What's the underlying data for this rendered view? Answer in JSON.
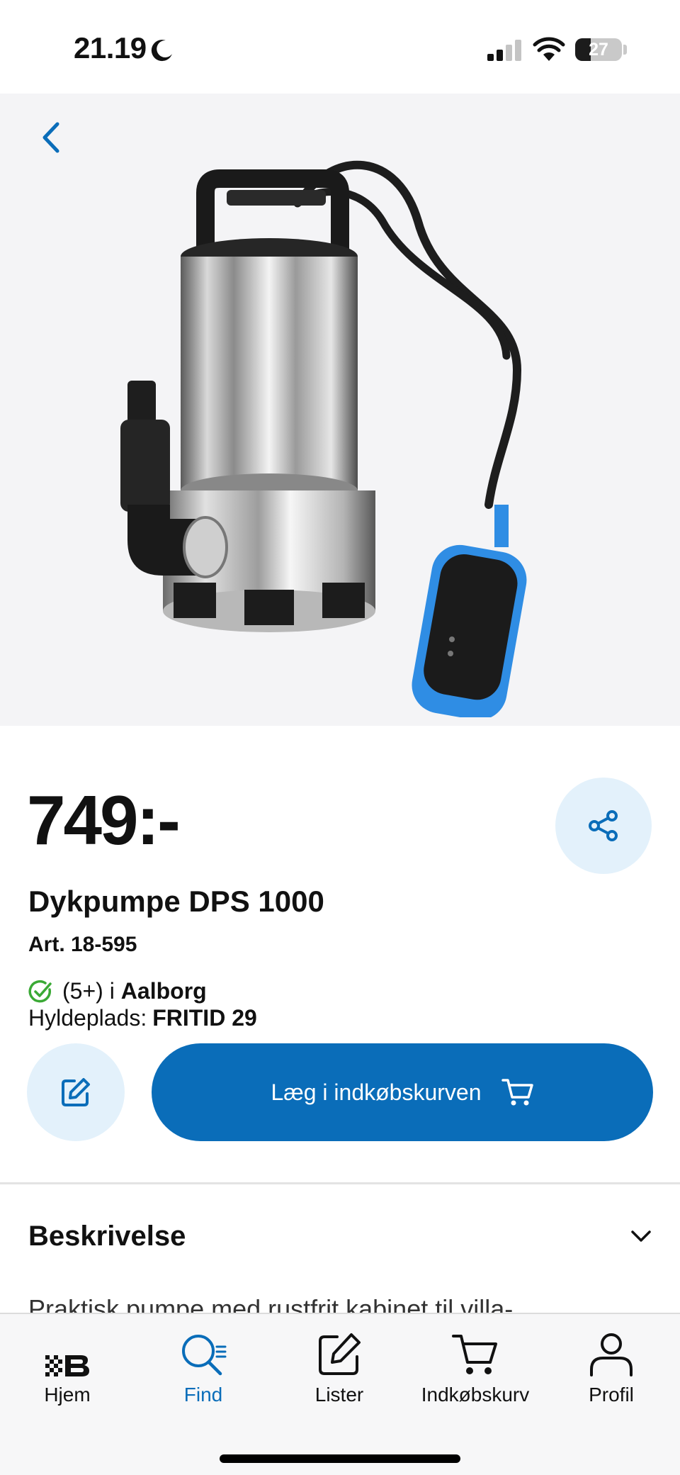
{
  "status_bar": {
    "time": "21.19",
    "battery": "27"
  },
  "product": {
    "price": "749:-",
    "title": "Dykpumpe DPS 1000",
    "article": "Art. 18-595",
    "stock_count": "(5+) i",
    "store": "Aalborg",
    "shelf_label": "Hyldeplads:",
    "shelf_value": "FRITID 29"
  },
  "actions": {
    "add_to_cart_label": "Læg i indkøbskurven"
  },
  "description": {
    "title": "Beskrivelse",
    "text": "Praktisk pumpe med rustfrit kabinet til villa-"
  },
  "tabs": [
    {
      "label": "Hjem",
      "icon": "bauhaus-logo-icon",
      "active": false
    },
    {
      "label": "Find",
      "icon": "search-list-icon",
      "active": true
    },
    {
      "label": "Lister",
      "icon": "edit-note-icon",
      "active": false
    },
    {
      "label": "Indkøbskurv",
      "icon": "cart-icon",
      "active": false
    },
    {
      "label": "Profil",
      "icon": "person-icon",
      "active": false
    }
  ],
  "colors": {
    "accent": "#0a6db9",
    "accent_light": "#e3f1fb",
    "in_stock_green": "#3aa935",
    "float_switch_blue": "#2f8de4"
  }
}
